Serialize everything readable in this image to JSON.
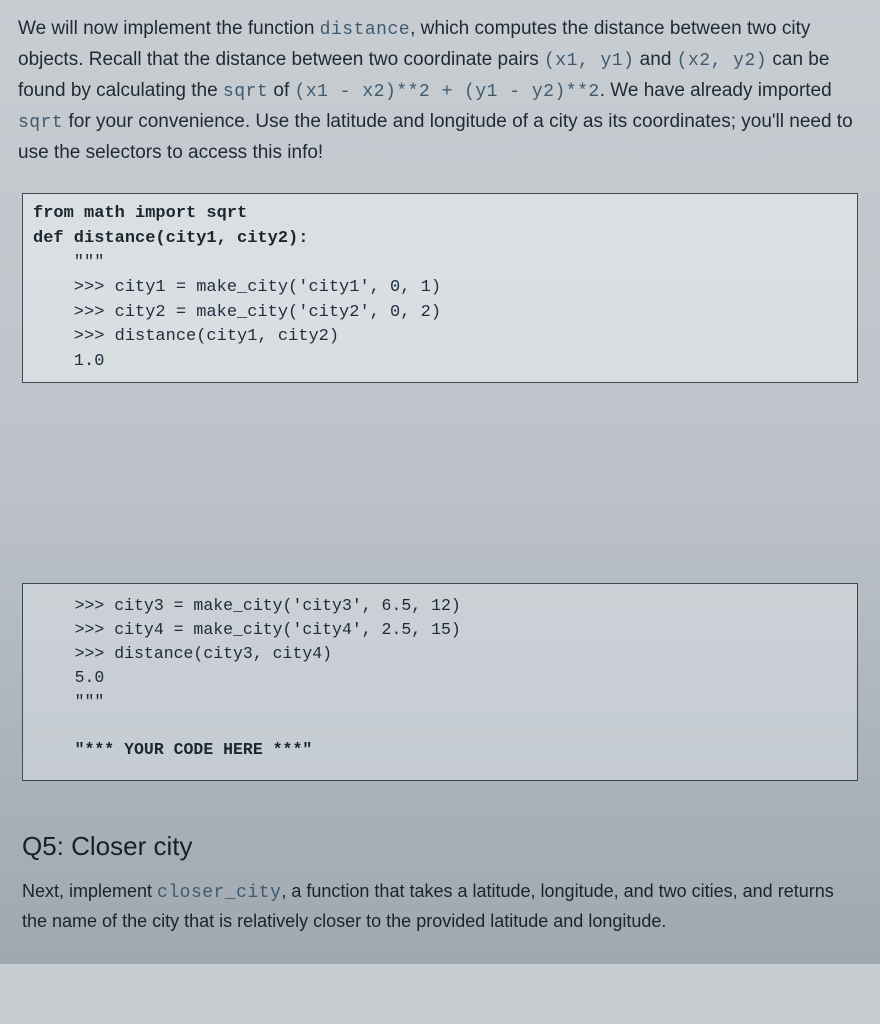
{
  "intro": {
    "t1a": "We will now implement the function ",
    "t1b_code": "distance",
    "t1c": ", which computes the distance between two city objects. Recall that the distance between two coordinate pairs ",
    "t1d_code": "(x1, y1)",
    "t1e": " and ",
    "t1f_code": "(x2, y2)",
    "t1g": " can be found by calculating the ",
    "t1h_code": "sqrt",
    "t1i": " of ",
    "t1j_code": "(x1 - x2)**2 + (y1 - y2)**2",
    "t1k": ". We have already imported ",
    "t1l_code": "sqrt",
    "t1m": " for your convenience. Use the latitude and longitude of a city as its coordinates; you'll need to use the selectors to access this info!"
  },
  "code1": {
    "l1": "from math import sqrt",
    "l2": "def distance(city1, city2):",
    "l3": "    \"\"\"",
    "l4": "    >>> city1 = make_city('city1', 0, 1)",
    "l5": "    >>> city2 = make_city('city2', 0, 2)",
    "l6": "    >>> distance(city1, city2)",
    "l7": "    1.0"
  },
  "code2": {
    "l1": "    >>> city3 = make_city('city3', 6.5, 12)",
    "l2": "    >>> city4 = make_city('city4', 2.5, 15)",
    "l3": "    >>> distance(city3, city4)",
    "l4": "    5.0",
    "l5": "    \"\"\"",
    "blank": "",
    "l6": "    \"*** YOUR CODE HERE ***\""
  },
  "q5": {
    "heading": "Q5: Closer city",
    "p1a": "Next, implement ",
    "p1b_code": "closer_city",
    "p1c": ", a function that takes a latitude, longitude, and two cities, and returns the name of the city that is relatively closer to the provided latitude and longitude."
  }
}
